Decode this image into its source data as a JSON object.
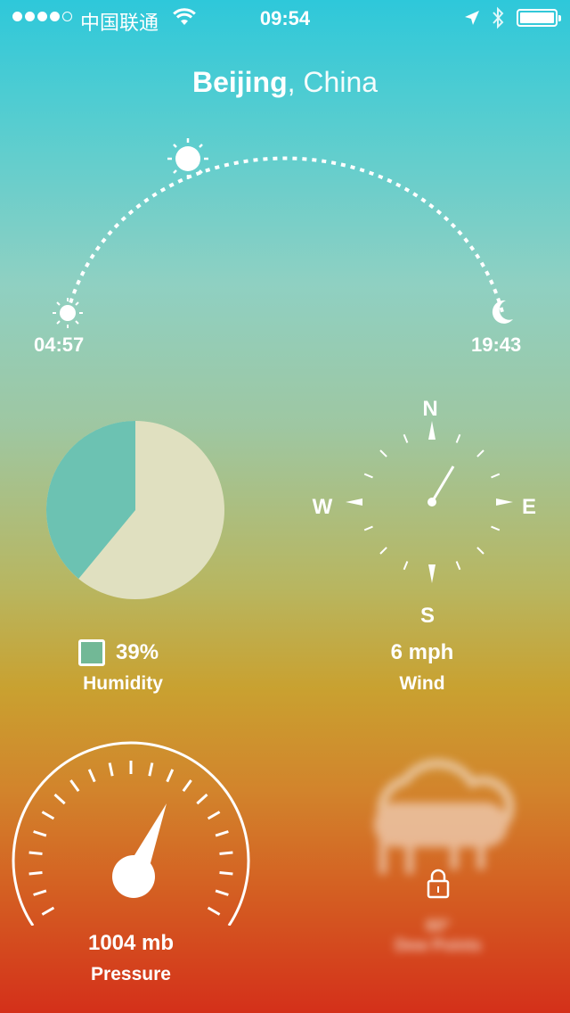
{
  "status_bar": {
    "carrier": "中国联通",
    "time": "09:54",
    "signal_bars_filled": 4,
    "signal_bars_total": 5,
    "battery_level": 1.0
  },
  "location": {
    "city": "Beijing",
    "separator": ", ",
    "country": "China"
  },
  "sun": {
    "sunrise": "04:57",
    "sunset": "19:43"
  },
  "humidity": {
    "value": "39%",
    "label": "Humidity",
    "fraction": 0.39,
    "color": "#6cc2b2",
    "remainder_color": "#e0e0c0"
  },
  "wind": {
    "value": "6 mph",
    "label": "Wind",
    "compass": {
      "n": "N",
      "s": "S",
      "e": "E",
      "w": "W"
    }
  },
  "pressure": {
    "value": "1004 mb",
    "label": "Pressure"
  },
  "dew_point": {
    "value": "60°",
    "label": "Dew Points",
    "locked": true
  },
  "icons": [
    "wifi-icon",
    "location-arrow-icon",
    "bluetooth-icon",
    "battery-icon",
    "sunrise-icon",
    "sun-icon",
    "moon-icon",
    "lock-icon",
    "cloud-rain-icon"
  ]
}
